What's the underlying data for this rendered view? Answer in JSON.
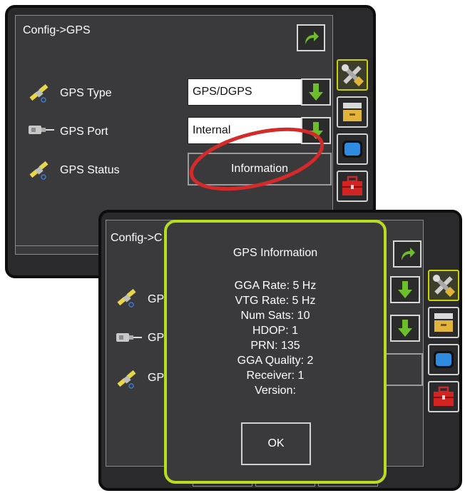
{
  "back_screen": {
    "title": "Config->GPS",
    "rows": [
      {
        "label": "GPS Type",
        "icon": "satellite-icon",
        "value": "GPS/DGPS"
      },
      {
        "label": "GPS Port",
        "icon": "antenna-connector-icon",
        "value": "Internal"
      },
      {
        "label": "GPS Status",
        "icon": "satellite-icon",
        "button": "Information"
      }
    ],
    "sidebar": [
      "tools-icon",
      "data-drawer-icon",
      "display-icon",
      "toolbox-icon"
    ]
  },
  "front_screen": {
    "title": "Config->C",
    "rows": [
      {
        "label": "GPS",
        "icon": "satellite-icon"
      },
      {
        "label": "GPS",
        "icon": "antenna-connector-icon"
      },
      {
        "label": "GPS",
        "icon": "satellite-icon"
      }
    ]
  },
  "dialog": {
    "title": "GPS Information",
    "lines": [
      "GGA Rate: 5 Hz",
      "VTG Rate: 5 Hz",
      "Num Sats: 10",
      "HDOP: 1",
      "PRN: 135",
      "GGA Quality: 2",
      "Receiver: 1",
      "Version:"
    ],
    "ok_label": "OK"
  },
  "colors": {
    "dialog_border": "#b6dd1f",
    "highlight_ellipse": "#d42a2a",
    "arrow_green": "#6cbf2a",
    "active_sidebar": "#c8d200"
  }
}
